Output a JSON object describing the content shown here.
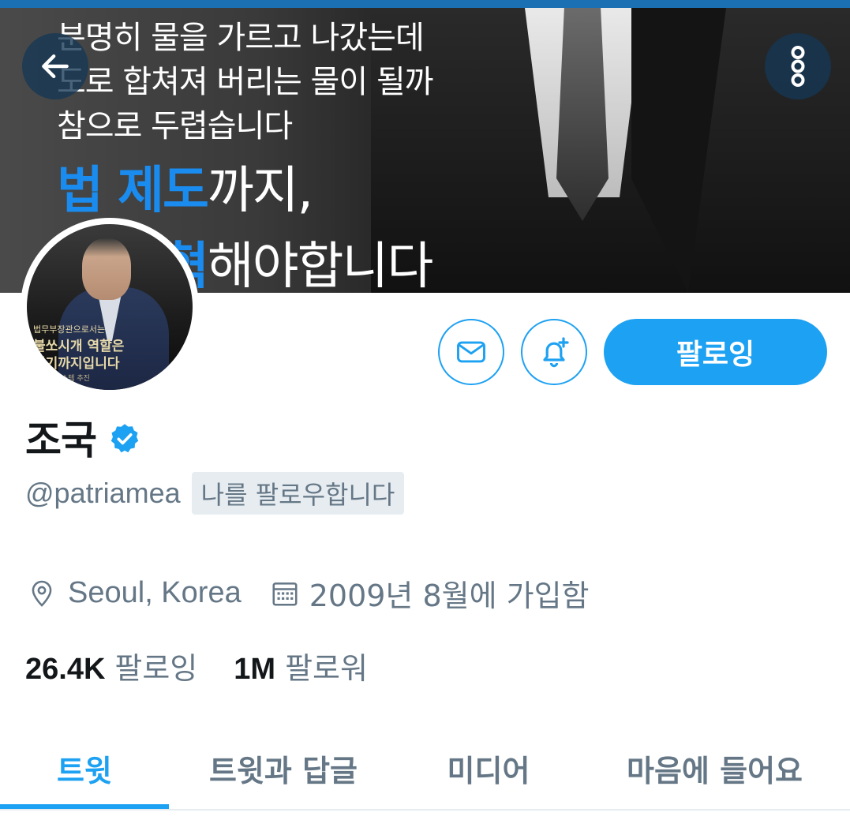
{
  "banner": {
    "line1": "분명히 물을 가르고 나갔는데",
    "line2": "도로 합쳐져 버리는 물이 될까",
    "line3": "참으로 두렵습니다",
    "line4_highlight": "법 제도",
    "line4_rest": "까지,",
    "line5_highlight": "되 개혁",
    "line5_rest": "해야합니다"
  },
  "avatar": {
    "text1": "법무부장관으로서는",
    "text2": "불쏘시개 역할은",
    "text3": "여기까지입니다",
    "text4": "개혁의 시스템 추진"
  },
  "actions": {
    "follow_label": "팔로잉"
  },
  "profile": {
    "name": "조국",
    "handle": "@patriamea",
    "follows_you": "나를 팔로우합니다",
    "location": "Seoul, Korea",
    "joined": "2009년 8월에 가입함"
  },
  "stats": {
    "following_count": "26.4K",
    "following_label": "팔로잉",
    "followers_count": "1M",
    "followers_label": "팔로워"
  },
  "tabs": [
    {
      "label": "트윗",
      "active": true
    },
    {
      "label": "트윗과 답글",
      "active": false
    },
    {
      "label": "미디어",
      "active": false
    },
    {
      "label": "마음에 들어요",
      "active": false
    }
  ],
  "colors": {
    "accent": "#1da1f2",
    "secondary_text": "#657786",
    "primary_text": "#14171a",
    "banner_highlight": "#1a8cf0"
  },
  "icons": {
    "back": "arrow-left-icon",
    "more": "more-vertical-icon",
    "message": "envelope-icon",
    "notify": "bell-plus-icon",
    "verified": "verified-badge-icon",
    "location": "location-pin-icon",
    "calendar": "calendar-icon"
  }
}
